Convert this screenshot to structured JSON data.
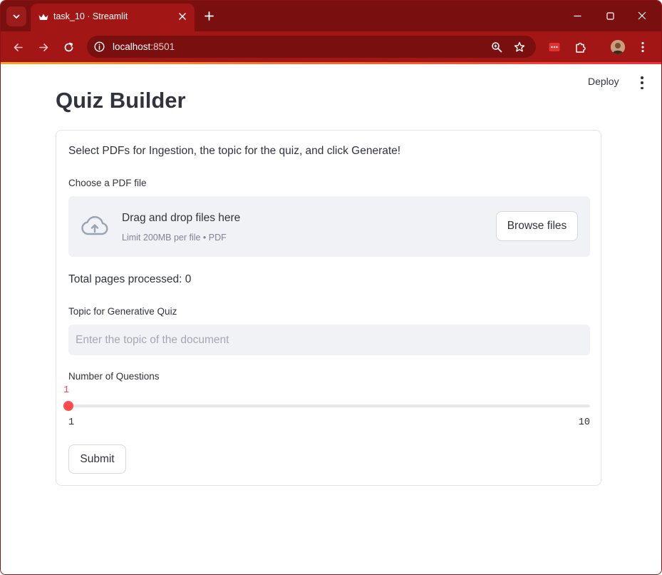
{
  "browser": {
    "tab_title": "task_10 · Streamlit",
    "url_host": "localhost",
    "url_port": ":8501",
    "theme_color": "#a31616",
    "icons": {
      "tab_menu": "chevron-down-icon",
      "favicon": "streamlit-crown-icon",
      "tab_close": "close-icon",
      "new_tab": "plus-icon",
      "minimize": "minimize-icon",
      "maximize": "maximize-icon",
      "close": "close-icon",
      "back": "back-arrow-icon",
      "forward": "forward-arrow-icon",
      "reload": "reload-icon",
      "site_info": "info-icon",
      "zoom": "zoom-icon",
      "bookmark": "star-icon",
      "extension": "extension-icon",
      "extensions": "puzzle-icon",
      "profile": "avatar",
      "menu": "more-vert-icon"
    }
  },
  "header": {
    "deploy_label": "Deploy",
    "menu_icon": "more-vert-icon"
  },
  "main": {
    "title": "Quiz Builder",
    "intro": "Select PDFs for Ingestion, the topic for the quiz, and click Generate!",
    "file_uploader": {
      "label": "Choose a PDF file",
      "title": "Drag and drop files here",
      "subtitle": "Limit 200MB per file • PDF",
      "button_label": "Browse files",
      "icon": "cloud-upload-icon"
    },
    "total_pages": "Total pages processed: 0",
    "topic": {
      "label": "Topic for Generative Quiz",
      "placeholder": "Enter the topic of the document",
      "value": ""
    },
    "questions_slider": {
      "label": "Number of Questions",
      "value": 1,
      "min": 1,
      "max": 10,
      "value_text": "1",
      "min_text": "1",
      "max_text": "10",
      "accent_color": "#ff4b4b"
    },
    "submit_label": "Submit"
  }
}
